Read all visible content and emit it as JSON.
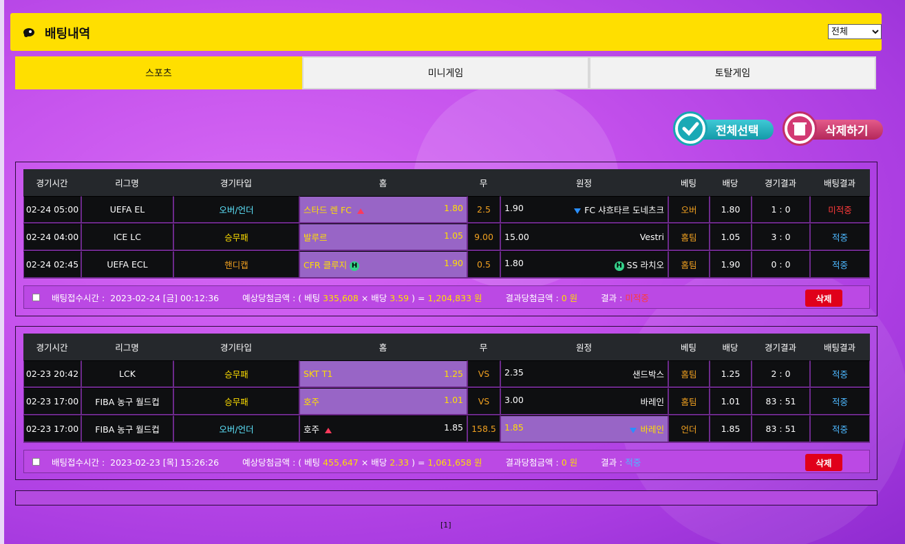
{
  "header": {
    "title": "배팅내역",
    "filter_value": "전체",
    "filter_options": [
      "전체"
    ]
  },
  "tabs": [
    {
      "label": "스포츠",
      "active": true
    },
    {
      "label": "미니게임",
      "active": false
    },
    {
      "label": "토탈게임",
      "active": false
    }
  ],
  "actions": {
    "select_all": "전체선택",
    "delete_all": "삭제하기"
  },
  "columns": [
    "경기시간",
    "리그명",
    "경기타입",
    "홈",
    "무",
    "원정",
    "베팅",
    "배당",
    "경기결과",
    "배팅결과"
  ],
  "slips": [
    {
      "rows": [
        {
          "time": "02-24 05:00",
          "league": "UEFA EL",
          "type": "오버/언더",
          "home": "스타드 렌 FC",
          "home_odd": "1.80",
          "draw": "2.5",
          "away_odd": "1.90",
          "away": "FC 샤흐타르 도네츠크",
          "bet": "오버",
          "odds": "1.80",
          "score": "1 : 0",
          "result": "미적중"
        },
        {
          "time": "02-24 04:00",
          "league": "ICE LC",
          "type": "승무패",
          "home": "발루르",
          "home_odd": "1.05",
          "draw": "9.00",
          "away_odd": "15.00",
          "away": "Vestri",
          "bet": "홈팀",
          "odds": "1.05",
          "score": "3 : 0",
          "result": "적중"
        },
        {
          "time": "02-24 02:45",
          "league": "UEFA ECL",
          "type": "핸디캡",
          "home": "CFR 클루지",
          "home_odd": "1.90",
          "draw": "0.5",
          "away_odd": "1.80",
          "away": "SS 라치오",
          "bet": "홈팀",
          "odds": "1.90",
          "score": "0 : 0",
          "result": "적중",
          "badge": "H"
        }
      ],
      "footer": {
        "time_label": "배팅접수시간 :",
        "time": "2023-02-24 [금] 00:12:36",
        "expected_label": "예상당첨금액 : ( 베팅",
        "bet_amount": "335,608",
        "times": "× 배당",
        "total_odds": "3.59",
        "eq": ") =",
        "expected": "1,204,833",
        "won": "원",
        "result_amount_label": "결과당첨금액 :",
        "result_amount": "0 원",
        "result_label": "결과 :",
        "result": "미적중",
        "delete": "삭제"
      }
    },
    {
      "rows": [
        {
          "time": "02-23 20:42",
          "league": "LCK",
          "type": "승무패",
          "home": "SKT T1",
          "home_odd": "1.25",
          "draw": "VS",
          "away_odd": "2.35",
          "away": "샌드박스",
          "bet": "홈팀",
          "odds": "1.25",
          "score": "2 : 0",
          "result": "적중"
        },
        {
          "time": "02-23 17:00",
          "league": "FIBA 농구 월드컵",
          "type": "승무패",
          "home": "호주",
          "home_odd": "1.01",
          "draw": "VS",
          "away_odd": "3.00",
          "away": "바레인",
          "bet": "홈팀",
          "odds": "1.01",
          "score": "83 : 51",
          "result": "적중"
        },
        {
          "time": "02-23 17:00",
          "league": "FIBA 농구 월드컵",
          "type": "오버/언더",
          "home": "호주",
          "home_odd": "1.85",
          "draw": "158.5",
          "away_odd": "1.85",
          "away": "바레인",
          "bet": "언더",
          "odds": "1.85",
          "score": "83 : 51",
          "result": "적중"
        }
      ],
      "footer": {
        "time_label": "배팅접수시간 :",
        "time": "2023-02-23 [목] 15:26:26",
        "expected_label": "예상당첨금액 : ( 베팅",
        "bet_amount": "455,647",
        "times": "× 배당",
        "total_odds": "2.33",
        "eq": ") =",
        "expected": "1,061,658",
        "won": "원",
        "result_amount_label": "결과당첨금액 :",
        "result_amount": "0 원",
        "result_label": "결과 :",
        "result": "적중",
        "delete": "삭제"
      }
    }
  ],
  "pager": "[1]",
  "colors": {
    "accent": "#ffdf00",
    "hit": "#4db8ff",
    "miss": "#ff3a3a"
  },
  "icons": {
    "header": "bomb-icon",
    "select_all": "check-icon",
    "delete_all": "trash-icon"
  }
}
